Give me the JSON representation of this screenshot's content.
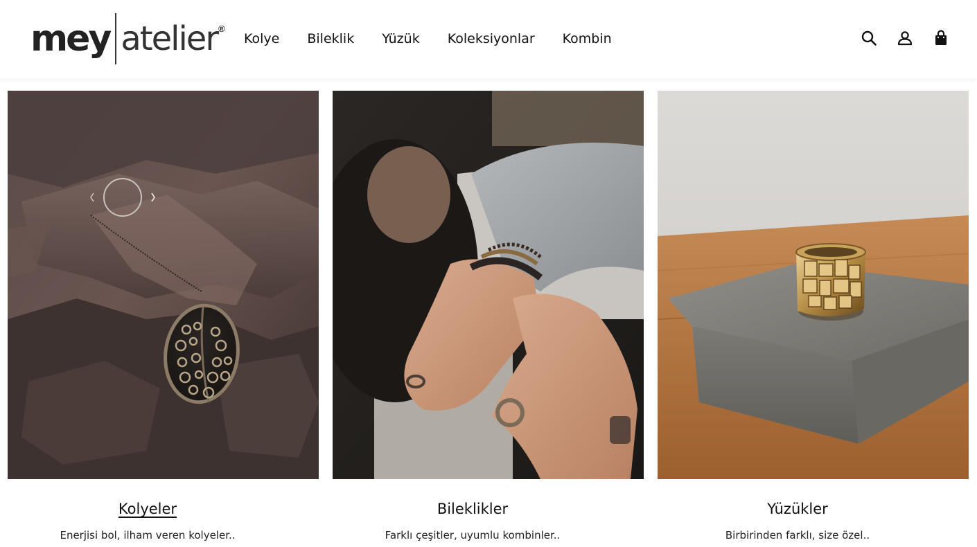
{
  "brand": {
    "name_left": "mey",
    "name_right": "atelier",
    "registered": "®"
  },
  "nav": {
    "items": [
      {
        "label": "Kolye"
      },
      {
        "label": "Bileklik"
      },
      {
        "label": "Yüzük"
      },
      {
        "label": "Koleksiyonlar"
      },
      {
        "label": "Kombin"
      }
    ]
  },
  "header_icons": [
    "search-icon",
    "account-icon",
    "shopping-bag-icon"
  ],
  "cards": [
    {
      "title": "Kolyeler",
      "description": "Enerjisi bol, ilham veren kolyeler..",
      "image": "necklace-on-rock"
    },
    {
      "title": "Bileklikler",
      "description": "Farklı çeşitler, uyumlu kombinler..",
      "image": "hands-with-bracelets"
    },
    {
      "title": "Yüzükler",
      "description": "Birbirinden farklı, size özel..",
      "image": "gold-ring-on-stone"
    }
  ],
  "colors": {
    "text": "#111111",
    "background": "#ffffff"
  }
}
